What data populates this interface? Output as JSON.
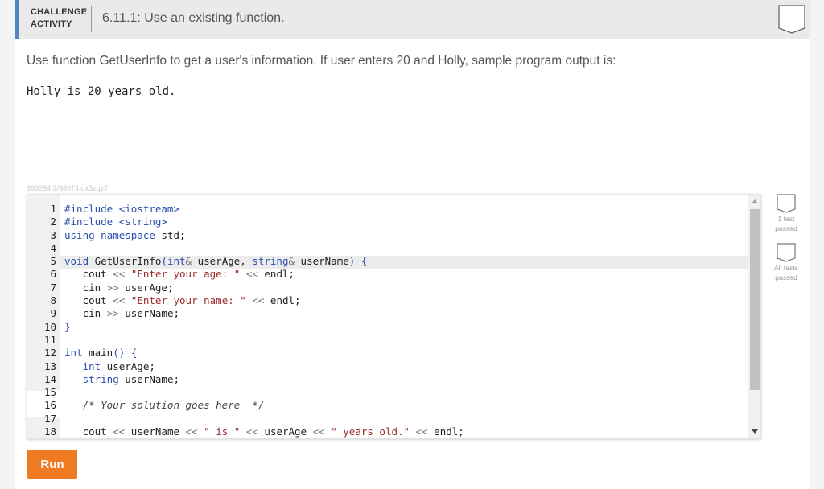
{
  "header": {
    "challenge_label_line1": "CHALLENGE",
    "challenge_label_line2": "ACTIVITY",
    "title": "6.11.1: Use an existing function."
  },
  "prompt": {
    "text": "Use function GetUserInfo to get a user's information. If user enters 20 and Holly, sample program output is:",
    "sample_output": "Holly is 20 years old."
  },
  "activity_id": "399284.2/96074.qx3zqy7",
  "editor": {
    "lines": [
      {
        "num": "1",
        "code": "#include <iostream>"
      },
      {
        "num": "2",
        "code": "#include <string>"
      },
      {
        "num": "3",
        "code": "using namespace std;"
      },
      {
        "num": "4",
        "code": ""
      },
      {
        "num": "5",
        "code": "void GetUserInfo(int& userAge, string& userName) {"
      },
      {
        "num": "6",
        "code": "   cout << \"Enter your age: \" << endl;"
      },
      {
        "num": "7",
        "code": "   cin >> userAge;"
      },
      {
        "num": "8",
        "code": "   cout << \"Enter your name: \" << endl;"
      },
      {
        "num": "9",
        "code": "   cin >> userName;"
      },
      {
        "num": "10",
        "code": "}"
      },
      {
        "num": "11",
        "code": ""
      },
      {
        "num": "12",
        "code": "int main() {"
      },
      {
        "num": "13",
        "code": "   int userAge;"
      },
      {
        "num": "14",
        "code": "   string userName;"
      },
      {
        "num": "15",
        "code": ""
      },
      {
        "num": "16",
        "code": "   /* Your solution goes here  */"
      },
      {
        "num": "17",
        "code": ""
      },
      {
        "num": "18",
        "code": "   cout << userName << \" is \" << userAge << \" years old.\" << endl;"
      }
    ]
  },
  "tests": [
    {
      "label_line1": "1 test",
      "label_line2": "passed",
      "icon": "test-badge-icon"
    },
    {
      "label_line1": "All tests",
      "label_line2": "passed",
      "icon": "test-badge-icon"
    }
  ],
  "run_button": {
    "label": "Run"
  },
  "colors": {
    "accent": "#5486c4",
    "run_button": "#f07a22",
    "keyword": "#2a4fb0",
    "string": "#9a2b2b"
  }
}
